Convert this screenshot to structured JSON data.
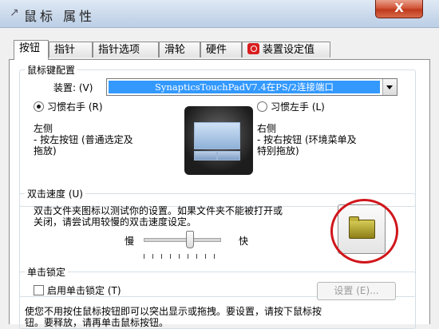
{
  "window": {
    "title": "鼠标 属性",
    "close_label": "X"
  },
  "tabs": [
    "按钮",
    "指针",
    "指针选项",
    "滑轮",
    "硬件",
    "装置设定值"
  ],
  "button_config": {
    "group_title": "鼠标键配置",
    "device_label": "装置: (V)",
    "device_value": "SynapticsTouchPadV7.4在PS/2连接端口",
    "right_hand_label": "习惯右手 (R)",
    "left_hand_label": "习惯左手 (L)",
    "left_side_title": "左侧",
    "left_side_desc1": " - 按左按钮 (普通选定及",
    "left_side_desc2": "拖放)",
    "right_side_title": "右侧",
    "right_side_desc1": " - 按右按钮 (环境菜单及",
    "right_side_desc2": "特别拖放)"
  },
  "double_click": {
    "group_title": "双击速度 (U)",
    "desc1": "双击文件夹图标以测试你的设置。如果文件夹不能被打开或",
    "desc2": "关闭，请尝试用较慢的双击速度设定。",
    "slow_label": "慢",
    "fast_label": "快",
    "speed_percent": 60
  },
  "click_lock": {
    "group_title": "单击锁定",
    "checkbox_label": "启用单击锁定 (T)",
    "settings_label": "设置 (E)...",
    "desc1": "使您不用按住鼠标按钮即可以突出显示或拖拽。要设置，请按下鼠标按",
    "desc2": "钮。要释放，请再单击鼠标按钮。"
  },
  "colors": {
    "accent_selection": "#3399ff",
    "close_red": "#c0391c",
    "highlight_circle": "#d0161b"
  }
}
